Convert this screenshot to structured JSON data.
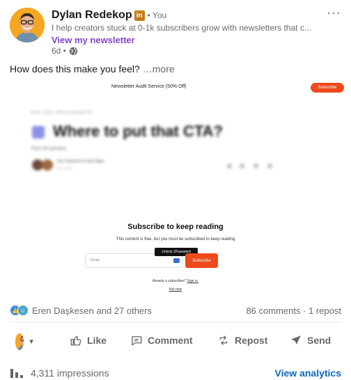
{
  "author": {
    "name": "Dylan Redekop",
    "badge": "in",
    "relation": "• You",
    "headline": "I help creators stuck at 0-1k subscribers grow with newsletters that c...",
    "newsletter_link": "View my newsletter",
    "time": "6d •",
    "visibility_icon": "globe-icon"
  },
  "more_menu": "···",
  "post": {
    "text": "How does this make you feel?",
    "see_more": "…more"
  },
  "media": {
    "topbar_title": "Newsletter Audit Service (50% Off)",
    "topbar_button": "Subscribe",
    "breadcrumb": "Home  >  Posts  >  Where to put that CTA?",
    "article_title": "Where to put that CTA?",
    "article_subtitle": "That's the question.",
    "authors": "Eren Daskesen & Capi Kotgun",
    "date": "Dec 1, 2024",
    "subscribe_heading": "Subscribe to keep reading",
    "subscribe_text": "This content is free, but you must be subscribed to keep reading",
    "tooltip": "Unlock 1Password",
    "email_placeholder": "Email",
    "subscribe_button": "Subscribe",
    "already_text": "Already a subscriber?",
    "sign_in": "Sign in.",
    "not_now": "Not now"
  },
  "social": {
    "reactions_text": "Eren Daşkesen and 27 others",
    "comments_reposts": "86 comments · 1 repost"
  },
  "actions": {
    "like": "Like",
    "comment": "Comment",
    "repost": "Repost",
    "send": "Send"
  },
  "footer": {
    "impressions": "4,311 impressions",
    "analytics": "View analytics"
  },
  "colors": {
    "brand_link": "#0a66c2",
    "newsletter_link": "#8344cc",
    "subscribe_orange": "#ee4a1b",
    "linkedin_badge": "#c37d16"
  }
}
